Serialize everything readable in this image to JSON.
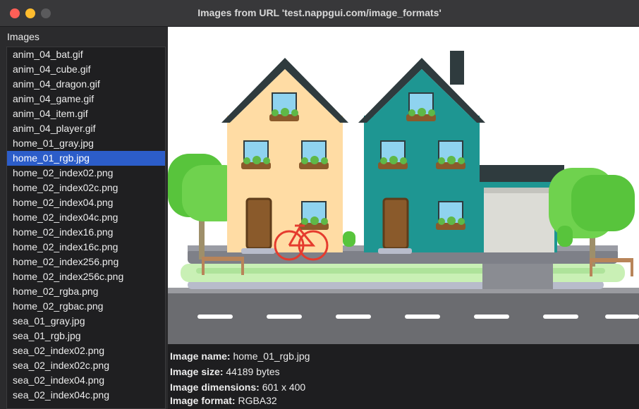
{
  "window": {
    "title": "Images from URL 'test.nappgui.com/image_formats'"
  },
  "sidebar": {
    "header": "Images",
    "items": [
      "anim_04_bat.gif",
      "anim_04_cube.gif",
      "anim_04_dragon.gif",
      "anim_04_game.gif",
      "anim_04_item.gif",
      "anim_04_player.gif",
      "home_01_gray.jpg",
      "home_01_rgb.jpg",
      "home_02_index02.png",
      "home_02_index02c.png",
      "home_02_index04.png",
      "home_02_index04c.png",
      "home_02_index16.png",
      "home_02_index16c.png",
      "home_02_index256.png",
      "home_02_index256c.png",
      "home_02_rgba.png",
      "home_02_rgbac.png",
      "sea_01_gray.jpg",
      "sea_01_rgb.jpg",
      "sea_02_index02.png",
      "sea_02_index02c.png",
      "sea_02_index04.png",
      "sea_02_index04c.png"
    ],
    "selected": "home_01_rgb.jpg"
  },
  "info": {
    "name_label": "Image name:",
    "name_value": "home_01_rgb.jpg",
    "size_label": "Image size:",
    "size_value": "44189 bytes",
    "dims_label": "Image dimensions:",
    "dims_value": "601 x 400",
    "format_label": "Image format:",
    "format_value": "RGBA32"
  },
  "colors": {
    "close": "#ff5f57",
    "minimize": "#febc2e",
    "maximize": "#5a5a5c",
    "selection": "#2c5dc9"
  }
}
